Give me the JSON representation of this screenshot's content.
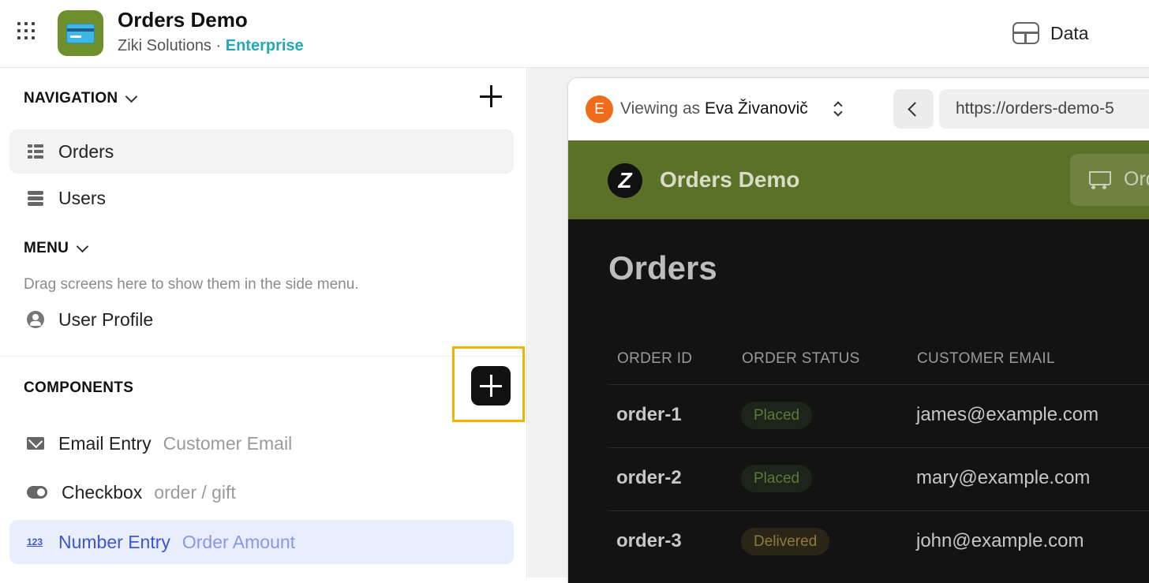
{
  "topbar": {
    "app_title": "Orders Demo",
    "org": "Ziki Solutions",
    "separator": "·",
    "tier": "Enterprise",
    "data_label": "Data"
  },
  "sidebar": {
    "navigation_title": "NAVIGATION",
    "nav_items": [
      {
        "label": "Orders",
        "icon": "table-icon"
      },
      {
        "label": "Users",
        "icon": "database-icon"
      }
    ],
    "menu_title": "MENU",
    "menu_hint": "Drag screens here to show them in the side menu.",
    "menu_items": [
      {
        "label": "User Profile",
        "icon": "user-icon"
      }
    ],
    "components_title": "COMPONENTS",
    "components": [
      {
        "label": "Email Entry",
        "sub": "Customer Email",
        "icon": "email-icon"
      },
      {
        "label": "Checkbox",
        "sub": "order / gift",
        "icon": "toggle-icon"
      },
      {
        "label": "Number Entry",
        "sub": "Order Amount",
        "icon": "number-icon",
        "icon_text": "123"
      }
    ]
  },
  "preview": {
    "viewing_prefix": "Viewing as",
    "viewing_user": "Eva Živanovič",
    "avatar_letter": "E",
    "url": "https://orders-demo-5",
    "app_title": "Orders Demo",
    "logo_letter": "Z",
    "cart_label": "Ord",
    "page_title": "Orders",
    "columns": [
      "ORDER ID",
      "ORDER STATUS",
      "CUSTOMER EMAIL"
    ],
    "rows": [
      {
        "id": "order-1",
        "status": "Placed",
        "email": "james@example.com"
      },
      {
        "id": "order-2",
        "status": "Placed",
        "email": "mary@example.com"
      },
      {
        "id": "order-3",
        "status": "Delivered",
        "email": "john@example.com"
      }
    ]
  },
  "colors": {
    "accent_tier": "#22a9b8",
    "app_header": "#5c7128",
    "highlight_frame": "#f2b400",
    "selected_item_bg": "#e8eefc"
  }
}
